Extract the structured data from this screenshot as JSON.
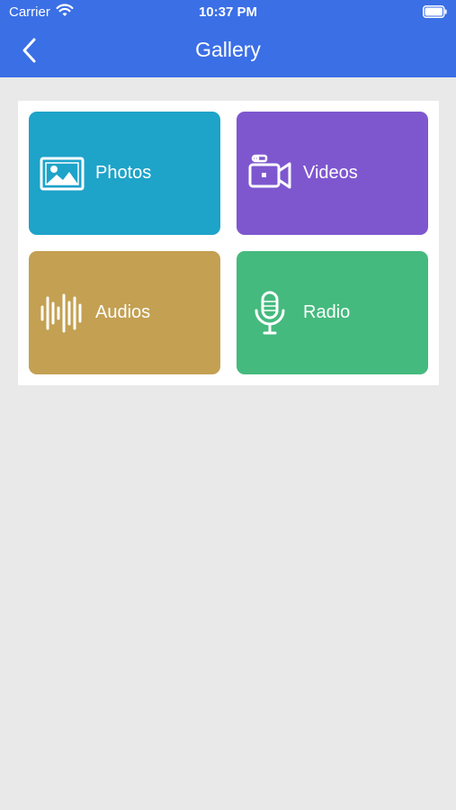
{
  "status_bar": {
    "carrier": "Carrier",
    "time": "10:37 PM"
  },
  "header": {
    "title": "Gallery",
    "back_icon": "chevron-left-icon"
  },
  "tiles": [
    {
      "label": "Photos",
      "icon": "image-icon",
      "color": "#1ea3c9"
    },
    {
      "label": "Videos",
      "icon": "video-camera-icon",
      "color": "#7e57cf"
    },
    {
      "label": "Audios",
      "icon": "sound-wave-icon",
      "color": "#c3a052"
    },
    {
      "label": "Radio",
      "icon": "microphone-icon",
      "color": "#45ba7e"
    }
  ],
  "colors": {
    "header_bg": "#3b6fe6",
    "page_bg": "#e9e9e9",
    "panel_bg": "#ffffff"
  }
}
